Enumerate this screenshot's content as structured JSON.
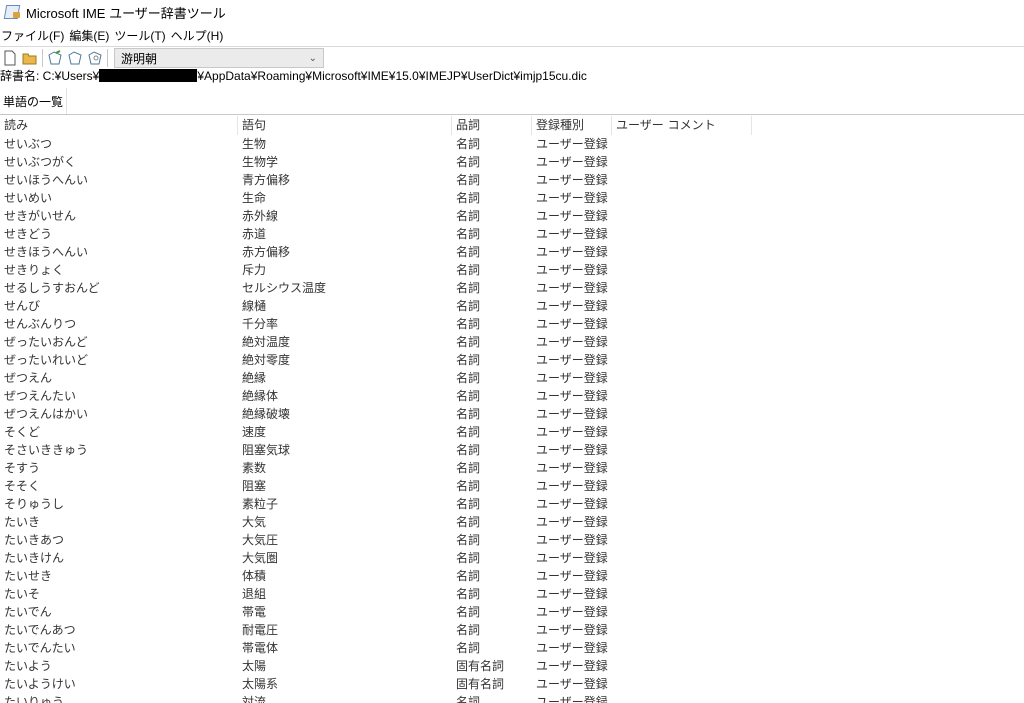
{
  "window": {
    "title": "Microsoft IME ユーザー辞書ツール",
    "icon": "dictionary-tool-icon"
  },
  "menu": [
    "ファイル(F)",
    "編集(E)",
    "ツール(T)",
    "ヘルプ(H)"
  ],
  "toolbar": {
    "buttons": [
      "new-file-icon",
      "open-folder-icon",
      "add-word-icon",
      "edit-word-icon",
      "delete-word-icon"
    ],
    "font_select": {
      "value": "游明朝"
    }
  },
  "path": {
    "label": "辞書名: C:¥Users¥",
    "redacted": true,
    "suffix": "¥AppData¥Roaming¥Microsoft¥IME¥15.0¥IMEJP¥UserDict¥imjp15cu.dic"
  },
  "tabs": [
    "単語の一覧"
  ],
  "table": {
    "columns": [
      "読み",
      "語句",
      "品詞",
      "登録種別",
      "ユーザー コメント"
    ],
    "rows": [
      [
        "せいぶつ",
        "生物",
        "名詞",
        "ユーザー登録"
      ],
      [
        "せいぶつがく",
        "生物学",
        "名詞",
        "ユーザー登録"
      ],
      [
        "せいほうへんい",
        "青方偏移",
        "名詞",
        "ユーザー登録"
      ],
      [
        "せいめい",
        "生命",
        "名詞",
        "ユーザー登録"
      ],
      [
        "せきがいせん",
        "赤外線",
        "名詞",
        "ユーザー登録"
      ],
      [
        "せきどう",
        "赤道",
        "名詞",
        "ユーザー登録"
      ],
      [
        "せきほうへんい",
        "赤方偏移",
        "名詞",
        "ユーザー登録"
      ],
      [
        "せきりょく",
        "斥力",
        "名詞",
        "ユーザー登録"
      ],
      [
        "せるしうすおんど",
        "セルシウス温度",
        "名詞",
        "ユーザー登録"
      ],
      [
        "せんび",
        "線樋",
        "名詞",
        "ユーザー登録"
      ],
      [
        "せんぶんりつ",
        "千分率",
        "名詞",
        "ユーザー登録"
      ],
      [
        "ぜったいおんど",
        "絶対温度",
        "名詞",
        "ユーザー登録"
      ],
      [
        "ぜったいれいど",
        "絶対零度",
        "名詞",
        "ユーザー登録"
      ],
      [
        "ぜつえん",
        "絶縁",
        "名詞",
        "ユーザー登録"
      ],
      [
        "ぜつえんたい",
        "絶縁体",
        "名詞",
        "ユーザー登録"
      ],
      [
        "ぜつえんはかい",
        "絶縁破壊",
        "名詞",
        "ユーザー登録"
      ],
      [
        "そくど",
        "速度",
        "名詞",
        "ユーザー登録"
      ],
      [
        "そさいききゅう",
        "阻塞気球",
        "名詞",
        "ユーザー登録"
      ],
      [
        "そすう",
        "素数",
        "名詞",
        "ユーザー登録"
      ],
      [
        "そそく",
        "阻塞",
        "名詞",
        "ユーザー登録"
      ],
      [
        "そりゅうし",
        "素粒子",
        "名詞",
        "ユーザー登録"
      ],
      [
        "たいき",
        "大気",
        "名詞",
        "ユーザー登録"
      ],
      [
        "たいきあつ",
        "大気圧",
        "名詞",
        "ユーザー登録"
      ],
      [
        "たいきけん",
        "大気圏",
        "名詞",
        "ユーザー登録"
      ],
      [
        "たいせき",
        "体積",
        "名詞",
        "ユーザー登録"
      ],
      [
        "たいそ",
        "退組",
        "名詞",
        "ユーザー登録"
      ],
      [
        "たいでん",
        "帯電",
        "名詞",
        "ユーザー登録"
      ],
      [
        "たいでんあつ",
        "耐電圧",
        "名詞",
        "ユーザー登録"
      ],
      [
        "たいでんたい",
        "帯電体",
        "名詞",
        "ユーザー登録"
      ],
      [
        "たいよう",
        "太陽",
        "固有名詞",
        "ユーザー登録"
      ],
      [
        "たいようけい",
        "太陽系",
        "固有名詞",
        "ユーザー登録"
      ],
      [
        "たいりゅう",
        "対流",
        "名詞",
        "ユーザー登録"
      ]
    ]
  }
}
